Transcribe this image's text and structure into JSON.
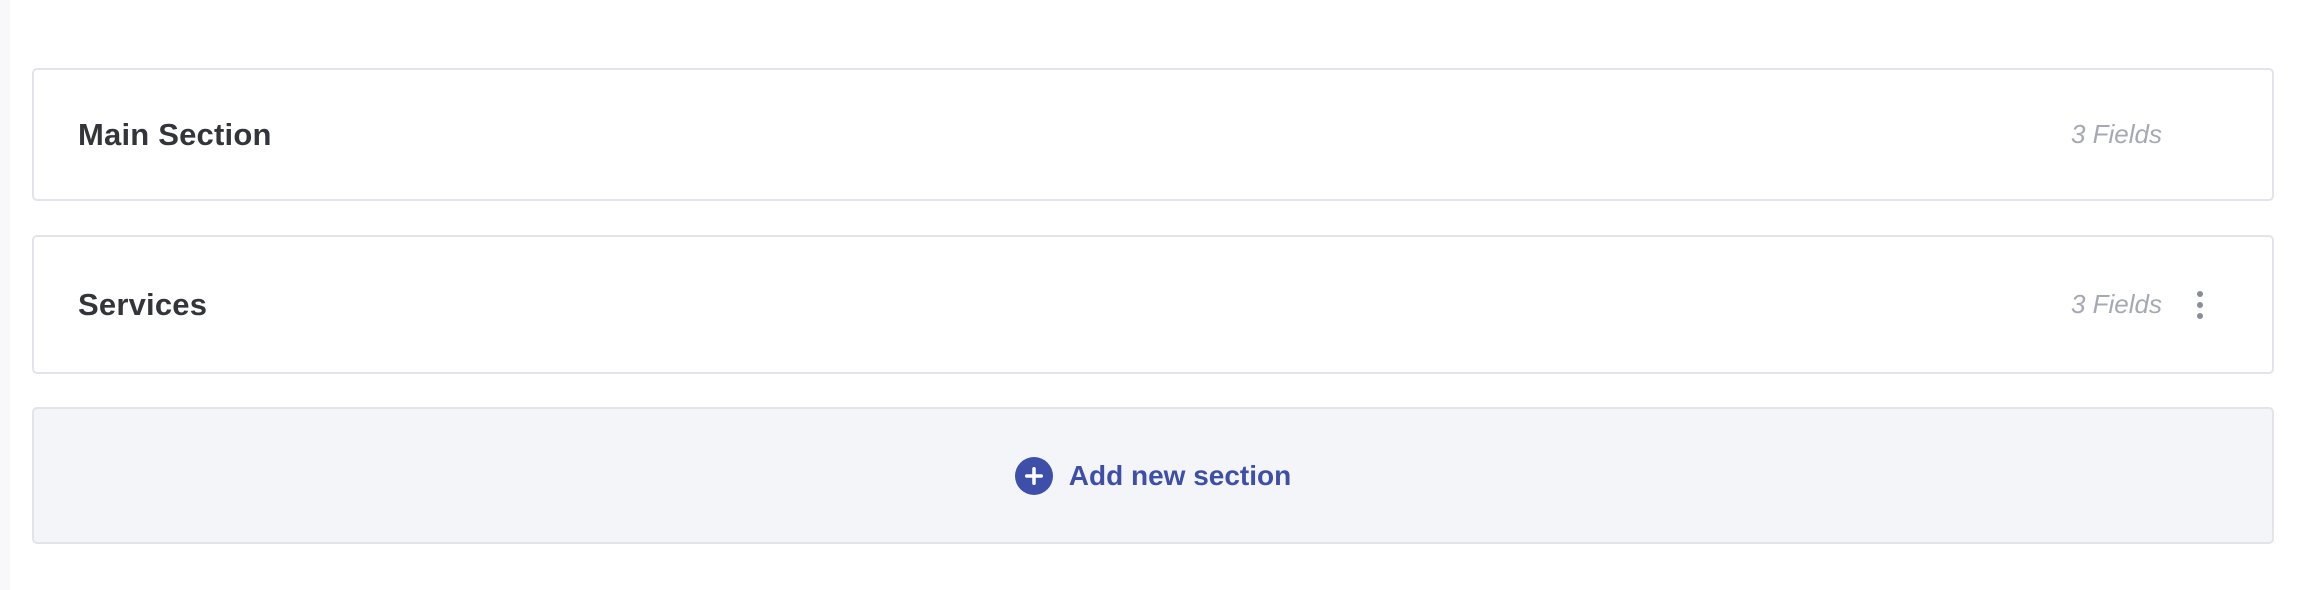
{
  "sections": [
    {
      "title": "Main Section",
      "fields_count": "3 Fields"
    },
    {
      "title": "Services",
      "fields_count": "3 Fields"
    }
  ],
  "add_section": {
    "label": "Add new section",
    "icon": "plus-circle-icon"
  },
  "colors": {
    "accent": "#3d4fa8",
    "border": "#e3e4ea",
    "muted_text": "#a6a8b5",
    "title_text": "#33353a",
    "add_background": "#f4f5f9"
  },
  "icons": {
    "more": "vertical-ellipsis-icon"
  }
}
